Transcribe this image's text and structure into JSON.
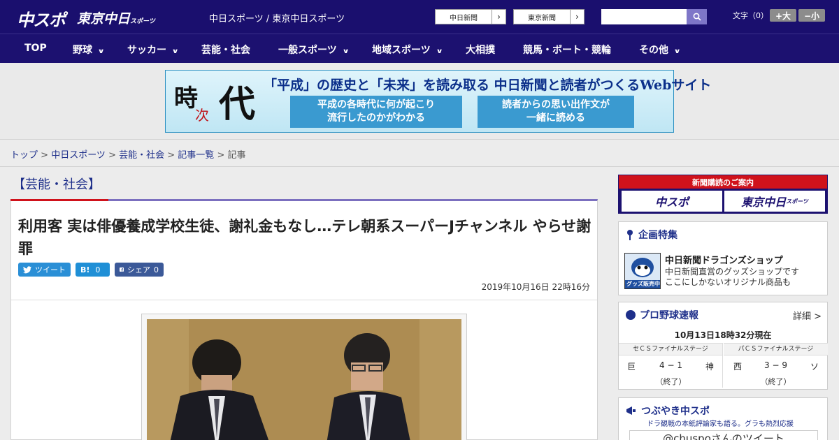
{
  "header": {
    "logo_main": "中スポ",
    "logo_sub": "東京中日",
    "logo_sub_small": "スポーツ",
    "site_names": "中日スポーツ / 東京中日スポーツ",
    "site_links": [
      {
        "label": "中日新聞",
        "arrow": "›"
      },
      {
        "label": "東京新聞",
        "arrow": "›"
      }
    ],
    "search": {
      "placeholder": ""
    },
    "font_size_label": "文字（0）",
    "font_larger": "+大",
    "font_smaller": "−小"
  },
  "nav": {
    "items": [
      {
        "label": "TOP"
      },
      {
        "label": "野球",
        "chevron": "∨"
      },
      {
        "label": "サッカー",
        "chevron": "∨"
      },
      {
        "label": "芸能・社会"
      },
      {
        "label": "一般スポーツ",
        "chevron": "∨"
      },
      {
        "label": "地域スポーツ",
        "chevron": "∨"
      },
      {
        "label": "大相撲"
      },
      {
        "label": "競馬・ボート・競輪"
      },
      {
        "label": "その他",
        "chevron": "∨"
      }
    ]
  },
  "banner": {
    "logo_a": "時",
    "logo_b": "次",
    "logo_c": "代",
    "headline": "「平成」の歴史と「未来」を読み取る 中日新聞と読者がつくるWebサイト",
    "box1": [
      "平成の各時代に何が起こり",
      "流行したのかがわかる"
    ],
    "box2": [
      "読者からの思い出作文が",
      "一緒に読める"
    ]
  },
  "breadcrumb": {
    "items": [
      "トップ",
      "中日スポーツ",
      "芸能・社会",
      "記事一覧"
    ],
    "current": "記事",
    "sep": " > "
  },
  "article": {
    "category": "【芸能・社会】",
    "headline": "利用客 実は俳優養成学校生徒、謝礼金もなし…テレ朝系スーパーJチャンネル やらせ謝罪",
    "share": {
      "tweet": "ツイート",
      "hatena": "B!",
      "hatena_count": "0",
      "facebook": "シェア",
      "facebook_count": "0"
    },
    "datetime": "2019年10月16日 22時16分"
  },
  "sidebar": {
    "subscribe": {
      "title": "新聞購読のご案内",
      "btn1": "中スポ",
      "btn2": "東京中日",
      "btn2_small": "スポーツ"
    },
    "feature": {
      "title": "企画特集",
      "shop_title": "中日新聞ドラゴンズショップ",
      "shop_desc1": "中日新聞直営のグッズショップです",
      "shop_desc2": "ここにしかないオリジナル商品も",
      "mascot_caption": "グッズ販売中"
    },
    "baseball": {
      "title": "プロ野球速報",
      "detail": "詳細 >",
      "updated": "10月13日18時32分現在",
      "games": [
        {
          "stage": "セＣＳファイナルステージ",
          "home": "巨",
          "score": "4 − 1",
          "away": "神",
          "status": "（終了）"
        },
        {
          "stage": "パＣＳファイナルステージ",
          "home": "西",
          "score": "3 − 9",
          "away": "ソ",
          "status": "（終了）"
        }
      ]
    },
    "tweets": {
      "title": "つぶやき中スポ",
      "subtitle": "ドラ観戦の本紙評論家も語る。グラも熱烈応援",
      "account": "@chuspoさんのツイート"
    }
  },
  "colors": {
    "brand": "#1a0f6e",
    "accent_red": "#d0121b",
    "link": "#1e2f8a"
  }
}
